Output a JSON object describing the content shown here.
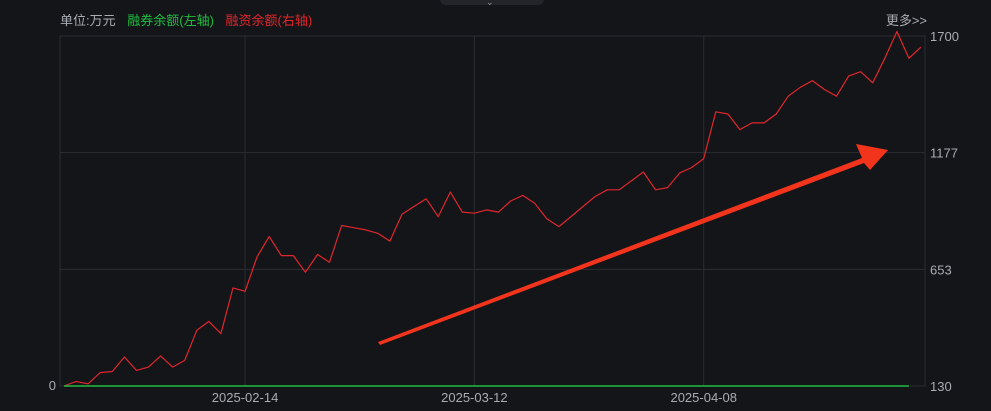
{
  "header": {
    "unit_label": "单位:万元",
    "more_label": "更多>>"
  },
  "chart_data": {
    "type": "line",
    "title": "",
    "xlabel": "",
    "ylabel": "",
    "legend_position": "top-left",
    "grid": true,
    "x_ticks": [
      "2025-02-14",
      "2025-03-12",
      "2025-04-08"
    ],
    "left_axis": {
      "ticks": [
        "0"
      ]
    },
    "right_axis": {
      "ticks": [
        "1700",
        "1177",
        "653",
        "130"
      ],
      "ylim": [
        130,
        1700
      ]
    },
    "series": [
      {
        "name": "融券余额(左轴)",
        "axis": "left",
        "color": "#1fbd3f",
        "values": [
          0,
          0,
          0,
          0,
          0,
          0,
          0,
          0,
          0,
          0,
          0,
          0,
          0,
          0,
          0,
          0,
          0,
          0,
          0,
          0,
          0,
          0,
          0,
          0,
          0,
          0,
          0,
          0,
          0,
          0,
          0,
          0,
          0,
          0,
          0,
          0,
          0,
          0,
          0,
          0,
          0,
          0,
          0,
          0,
          0,
          0,
          0,
          0,
          0,
          0,
          0,
          0,
          0,
          0,
          0,
          0,
          0,
          0,
          0,
          0,
          0,
          0,
          0,
          0,
          0,
          0,
          0,
          0,
          0,
          0,
          0
        ]
      },
      {
        "name": "融资余额(右轴)",
        "axis": "right",
        "color": "#e0262c",
        "values": [
          130,
          150,
          140,
          190,
          195,
          260,
          200,
          215,
          265,
          215,
          245,
          380,
          420,
          365,
          570,
          555,
          710,
          800,
          715,
          715,
          640,
          720,
          685,
          850,
          840,
          830,
          815,
          780,
          900,
          935,
          970,
          890,
          1000,
          910,
          905,
          920,
          910,
          960,
          985,
          950,
          880,
          845,
          890,
          935,
          980,
          1010,
          1010,
          1050,
          1090,
          1010,
          1020,
          1085,
          1110,
          1150,
          1360,
          1350,
          1280,
          1310,
          1310,
          1350,
          1430,
          1470,
          1500,
          1460,
          1430,
          1520,
          1540,
          1490,
          1600,
          1720,
          1600,
          1650
        ]
      }
    ],
    "annotations": [
      {
        "type": "arrow",
        "color": "#f2341c",
        "meaning": "upward trend"
      }
    ]
  }
}
